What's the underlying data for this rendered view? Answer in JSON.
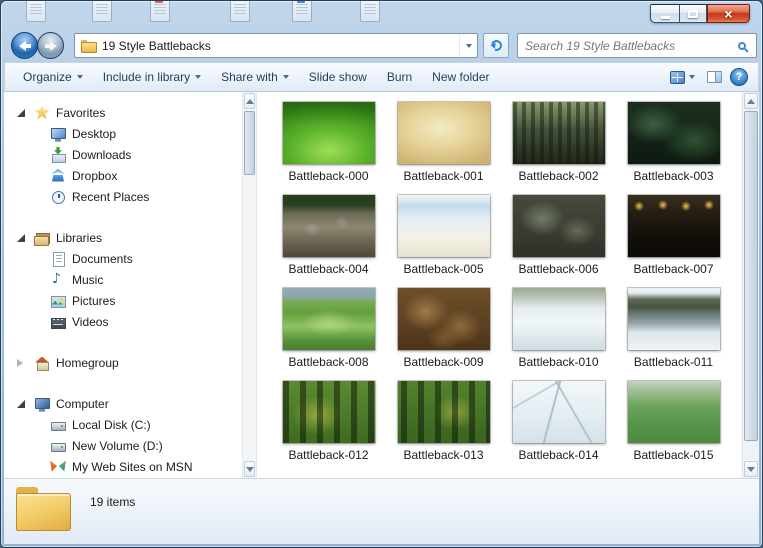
{
  "window": {
    "caption_buttons": {
      "minimize": "minimize",
      "maximize": "maximize",
      "close": "close"
    }
  },
  "navigation": {
    "address": "19 Style Battlebacks",
    "search_placeholder": "Search 19 Style Battlebacks",
    "icons": [
      "back-icon",
      "forward-icon",
      "folder-icon",
      "dropdown-icon",
      "refresh-icon",
      "search-icon"
    ]
  },
  "toolbar": {
    "items": [
      {
        "label": "Organize",
        "dropdown": true
      },
      {
        "label": "Include in library",
        "dropdown": true
      },
      {
        "label": "Share with",
        "dropdown": true
      },
      {
        "label": "Slide show",
        "dropdown": false
      },
      {
        "label": "Burn",
        "dropdown": false
      },
      {
        "label": "New folder",
        "dropdown": false
      }
    ],
    "right_icons": [
      "views-icon",
      "preview-pane-icon",
      "help-icon"
    ]
  },
  "sidebar": {
    "sections": [
      {
        "label": "Favorites",
        "expanded": true,
        "icon": "star-icon",
        "items": [
          {
            "label": "Desktop",
            "icon": "desktop-icon"
          },
          {
            "label": "Downloads",
            "icon": "downloads-icon"
          },
          {
            "label": "Dropbox",
            "icon": "dropbox-icon"
          },
          {
            "label": "Recent Places",
            "icon": "recent-places-icon"
          }
        ]
      },
      {
        "label": "Libraries",
        "expanded": true,
        "icon": "libraries-icon",
        "items": [
          {
            "label": "Documents",
            "icon": "documents-icon"
          },
          {
            "label": "Music",
            "icon": "music-icon"
          },
          {
            "label": "Pictures",
            "icon": "pictures-icon"
          },
          {
            "label": "Videos",
            "icon": "videos-icon"
          }
        ]
      },
      {
        "label": "Homegroup",
        "expanded": false,
        "icon": "homegroup-icon",
        "items": []
      },
      {
        "label": "Computer",
        "expanded": true,
        "icon": "computer-icon",
        "items": [
          {
            "label": "Local Disk (C:)",
            "icon": "drive-icon"
          },
          {
            "label": "New Volume (D:)",
            "icon": "drive-icon"
          },
          {
            "label": "My Web Sites on MSN",
            "icon": "msn-icon"
          }
        ]
      }
    ]
  },
  "files": [
    {
      "name": "Battleback-000",
      "desc": "green grassy meadow"
    },
    {
      "name": "Battleback-001",
      "desc": "sandy desert dunes"
    },
    {
      "name": "Battleback-002",
      "desc": "dark bamboo forest"
    },
    {
      "name": "Battleback-003",
      "desc": "dark green mist"
    },
    {
      "name": "Battleback-004",
      "desc": "rocky cliff with trees"
    },
    {
      "name": "Battleback-005",
      "desc": "pale sky with clouds"
    },
    {
      "name": "Battleback-006",
      "desc": "dark stone wall"
    },
    {
      "name": "Battleback-007",
      "desc": "dark dungeon with torches"
    },
    {
      "name": "Battleback-008",
      "desc": "green meadow with pond"
    },
    {
      "name": "Battleback-009",
      "desc": "tangled brown roots"
    },
    {
      "name": "Battleback-010",
      "desc": "snowy forest clearing"
    },
    {
      "name": "Battleback-011",
      "desc": "snowy river bank"
    },
    {
      "name": "Battleback-012",
      "desc": "forest with tree trunks"
    },
    {
      "name": "Battleback-013",
      "desc": "forest with tree trunks"
    },
    {
      "name": "Battleback-014",
      "desc": "cracked ice field"
    },
    {
      "name": "Battleback-015",
      "desc": "misty green field"
    }
  ],
  "status": {
    "items_text": "19 items"
  },
  "colors": {
    "accent_blue": "#2a6cb8",
    "close_red": "#c03a1e",
    "folder_yellow": "#f0c964"
  }
}
